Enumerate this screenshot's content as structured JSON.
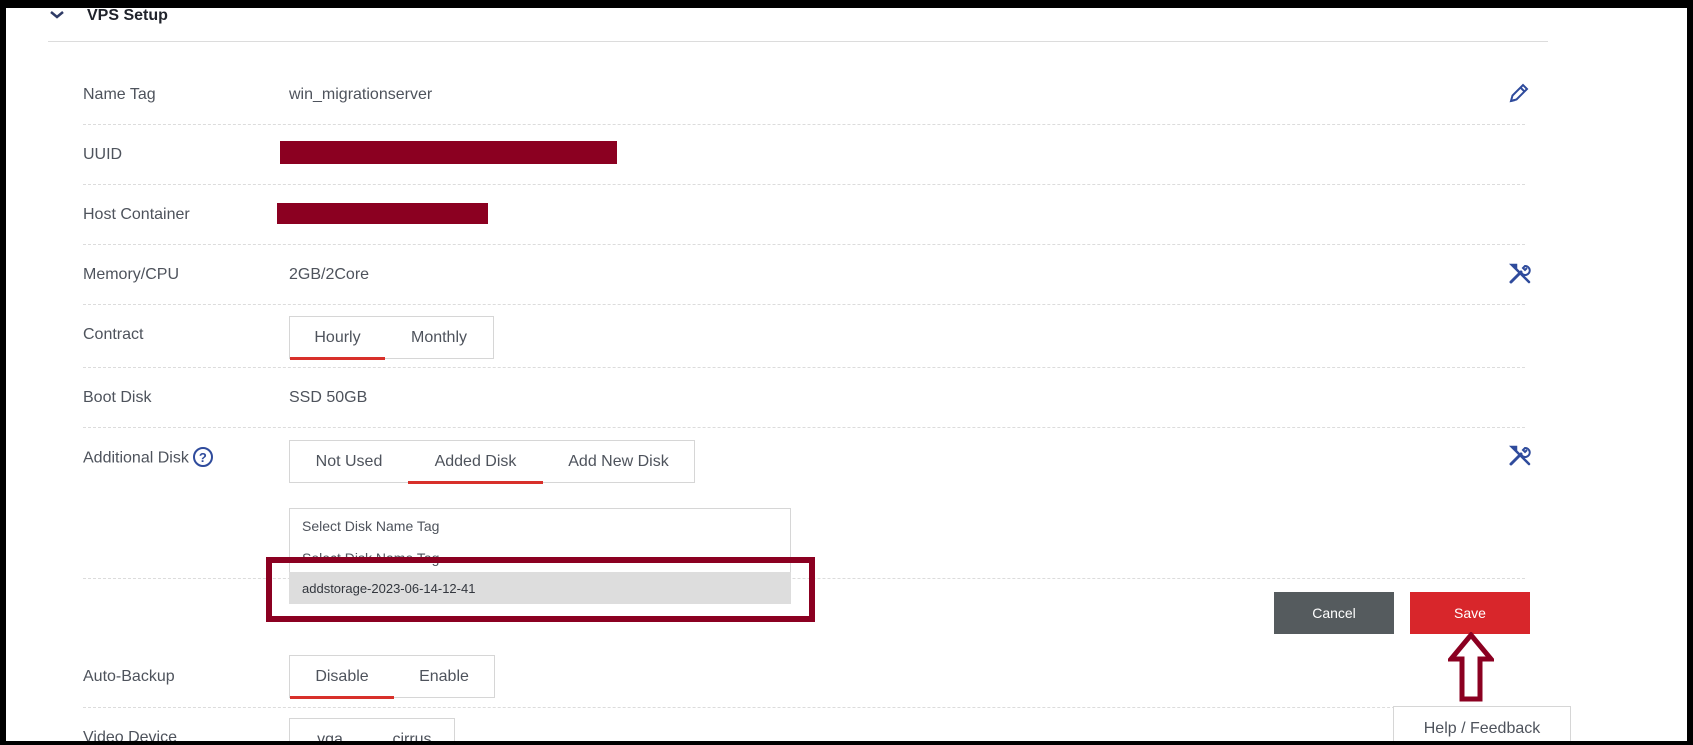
{
  "section": {
    "title": "VPS Setup",
    "toggle_icon": "chevron-down-icon"
  },
  "fields": {
    "name_tag": {
      "label": "Name Tag",
      "value": "win_migrationserver",
      "edit_icon": "pencil-icon"
    },
    "uuid": {
      "label": "UUID"
    },
    "host_container": {
      "label": "Host Container"
    },
    "memory_cpu": {
      "label": "Memory/CPU",
      "value": "2GB/2Core",
      "settings_icon": "tools-icon"
    },
    "contract": {
      "label": "Contract",
      "tabs": [
        "Hourly",
        "Monthly"
      ],
      "selected": "Hourly"
    },
    "boot_disk": {
      "label": "Boot Disk",
      "value": "SSD 50GB"
    },
    "additional_disk": {
      "label": "Additional Disk",
      "help_icon": "question-circle-icon",
      "tabs": [
        "Not Used",
        "Added Disk",
        "Add New Disk"
      ],
      "selected": "Added Disk",
      "settings_icon": "tools-icon",
      "select_placeholder": "Select Disk Name Tag",
      "options": [
        "Select Disk Name Tag",
        "addstorage-2023-06-14-12-41"
      ],
      "highlighted_option": "addstorage-2023-06-14-12-41"
    },
    "auto_backup": {
      "label": "Auto-Backup",
      "tabs": [
        "Disable",
        "Enable"
      ],
      "selected": "Disable"
    },
    "video_device": {
      "label": "Video Device",
      "tabs": [
        "vga",
        "cirrus"
      ]
    }
  },
  "actions": {
    "cancel_label": "Cancel",
    "save_label": "Save"
  },
  "help_feedback_label": "Help / Feedback",
  "colors": {
    "accent_red": "#d8262b",
    "redaction": "#8b0021",
    "icon_blue": "#2f4b9c",
    "cancel_gray": "#555b5e"
  }
}
